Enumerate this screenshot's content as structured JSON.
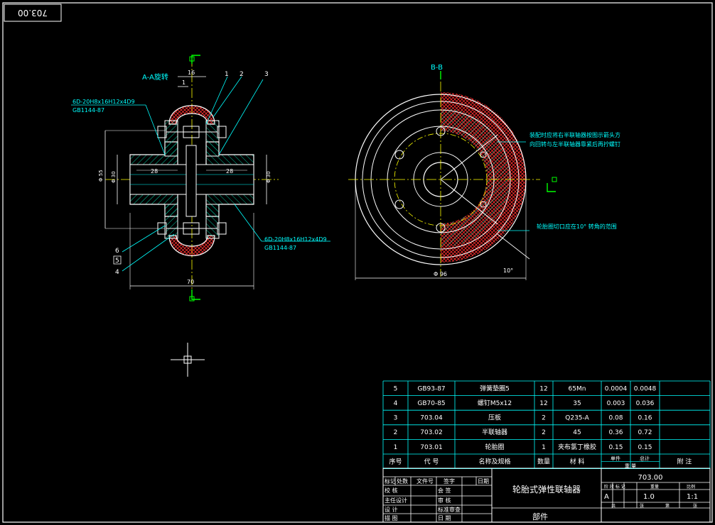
{
  "drawing_number_corner": "703.00",
  "colors": {
    "line_white": "#ffffff",
    "line_cyan": "#00ffff",
    "line_yellow": "#ffff00",
    "line_green": "#00ff00",
    "line_red": "#ff3030",
    "hatch_green": "#00c8a0"
  },
  "left_view": {
    "title": "A-A旋转",
    "thread_spec_top": "6D-20H8x16H12x4D9",
    "standard_top": "GB1144-87",
    "thread_spec_bottom": "6D-20H8x16H12x4D9",
    "standard_bottom": "GB1144-87",
    "dim_16": "16",
    "dim_1": "1",
    "dim_28_left": "28",
    "dim_28_right": "28",
    "dim_phi55": "Φ 55",
    "dim_phi30_left": "Φ 30",
    "dim_phi30_right": "Φ 30",
    "dim_70": "70",
    "balloons": [
      "1",
      "2",
      "3",
      "4",
      "5",
      "6"
    ]
  },
  "right_view": {
    "title": "B-B",
    "note_1_line1": "装配时应将右半联轴器按图示箭头方",
    "note_1_line2": "向回转与左半联轴器靠紧后再拧螺钉",
    "note_2": "轮胎圈切口应在10° 转角的范围",
    "dim_angle": "10°",
    "dim_diameter": "Φ 96"
  },
  "parts_list": {
    "rows": [
      {
        "no": "5",
        "code": "GB93-87",
        "name": "弹簧垫圈5",
        "qty": "12",
        "material": "65Mn",
        "unit_wt": "0.0004",
        "total_wt": "0.0048",
        "remark": ""
      },
      {
        "no": "4",
        "code": "GB70-85",
        "name": "螺钉M5x12",
        "qty": "12",
        "material": "35",
        "unit_wt": "0.003",
        "total_wt": "0.036",
        "remark": ""
      },
      {
        "no": "3",
        "code": "703.04",
        "name": "压板",
        "qty": "2",
        "material": "Q235-A",
        "unit_wt": "0.08",
        "total_wt": "0.16",
        "remark": ""
      },
      {
        "no": "2",
        "code": "703.02",
        "name": "半联轴器",
        "qty": "2",
        "material": "45",
        "unit_wt": "0.36",
        "total_wt": "0.72",
        "remark": ""
      },
      {
        "no": "1",
        "code": "703.01",
        "name": "轮胎圈",
        "qty": "1",
        "material": "夹布氯丁橡胶",
        "unit_wt": "0.15",
        "total_wt": "0.15",
        "remark": ""
      }
    ],
    "header": {
      "no": "序号",
      "code": "代 号",
      "name": "名称及规格",
      "qty": "数量",
      "material": "材  料",
      "unit": "单件",
      "total": "总计",
      "weight": "重 量",
      "remark": "附  注"
    }
  },
  "title_block": {
    "rev_headers": [
      "标记",
      "处数",
      "文件号",
      "签字",
      "日期"
    ],
    "rows_left": [
      "校   核",
      "主任设计",
      "设   计",
      "描   图"
    ],
    "rows_mid": [
      "会   签",
      "审   核",
      "标准审查",
      "日   期"
    ],
    "drawing_title": "轮胎式弹性联轴器",
    "category": "部件",
    "drawing_number": "703.00",
    "stage_headers": [
      "阶 段 标 记",
      "重量",
      "比例"
    ],
    "stage": "A",
    "weight": "1.0",
    "scale": "1:1",
    "sheet_labels": [
      "共",
      "张",
      "第",
      "张"
    ]
  }
}
